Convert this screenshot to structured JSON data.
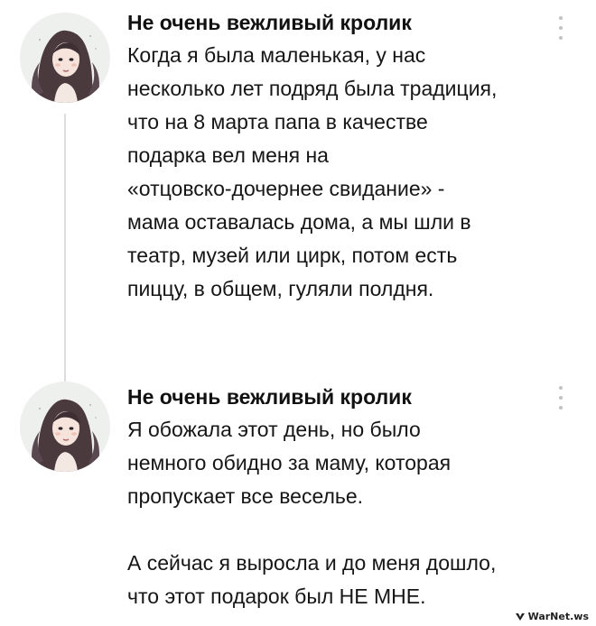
{
  "posts": [
    {
      "author": "Не очень вежливый кролик",
      "paragraphs": [
        "Когда я была маленькая, у нас\nнесколько лет подряд была традиция,\nчто на 8 марта папа в качестве\nподарка вел меня на\n«отцовско-дочернее свидание» -\nмама оставалась дома, а мы шли в\nтеатр, музей или цирк, потом есть\nпиццу, в общем, гуляли полдня."
      ]
    },
    {
      "author": "Не очень вежливый кролик",
      "paragraphs": [
        "Я обожала этот день, но было\nнемного обидно за маму, которая\nпропускает все веселье.",
        "А сейчас я выросла и до меня дошло,\nчто этот подарок был НЕ МНЕ."
      ]
    }
  ],
  "avatar_icon": "girl-portrait-illustration",
  "menu_icon": "more-vertical-icon",
  "watermark": "WarNet.ws",
  "colors": {
    "text": "#161616",
    "thread_line": "#dcdcdc",
    "menu_dots": "#c2c2c2"
  }
}
